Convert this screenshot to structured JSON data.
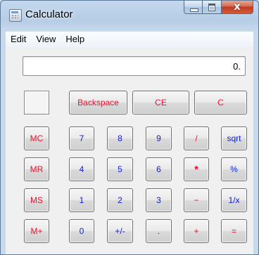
{
  "window": {
    "title": "Calculator",
    "icon": "calculator-icon",
    "controls": {
      "minimize": "minimize-icon",
      "maximize": "maximize-icon",
      "close_label": "x"
    }
  },
  "menu": {
    "items": [
      "Edit",
      "View",
      "Help"
    ]
  },
  "display": {
    "value": "0."
  },
  "colors": {
    "red_text": "#e8102a",
    "blue_text": "#1020d8",
    "close_button": "#c4462a"
  },
  "buttons": {
    "backspace": "Backspace",
    "ce": "CE",
    "c": "C",
    "mc": "MC",
    "mr": "MR",
    "ms": "MS",
    "mplus": "M+",
    "d7": "7",
    "d8": "8",
    "d9": "9",
    "d4": "4",
    "d5": "5",
    "d6": "6",
    "d1": "1",
    "d2": "2",
    "d3": "3",
    "d0": "0",
    "sign": "+/-",
    "dot": ".",
    "div": "/",
    "mul": "*",
    "sub": "−",
    "add": "+",
    "sqrt": "sqrt",
    "percent": "%",
    "reciprocal": "1/x",
    "equals": "="
  }
}
